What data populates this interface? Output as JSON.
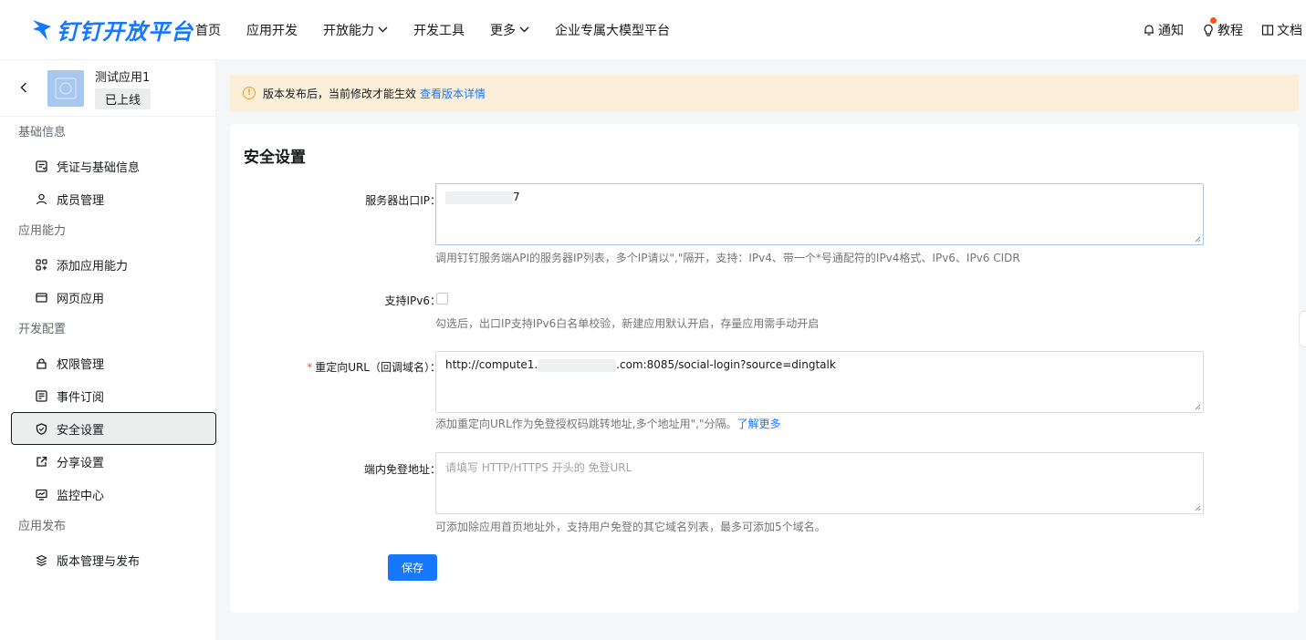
{
  "brand": {
    "name": "钉钉开放平台",
    "color": "#1677ff"
  },
  "nav": {
    "items": [
      {
        "label": "首页",
        "has_dropdown": false
      },
      {
        "label": "应用开发",
        "has_dropdown": false
      },
      {
        "label": "开放能力",
        "has_dropdown": true
      },
      {
        "label": "开发工具",
        "has_dropdown": false
      },
      {
        "label": "更多",
        "has_dropdown": true
      },
      {
        "label": "企业专属大模型平台",
        "has_dropdown": false
      }
    ],
    "right": {
      "notify": "通知",
      "tutorial": "教程",
      "docs": "文档"
    }
  },
  "app": {
    "name": "测试应用1",
    "status": "已上线"
  },
  "sidebar": {
    "groups": [
      {
        "title": "基础信息",
        "items": [
          {
            "label": "凭证与基础信息",
            "icon": "credential-icon"
          },
          {
            "label": "成员管理",
            "icon": "member-icon"
          }
        ]
      },
      {
        "title": "应用能力",
        "items": [
          {
            "label": "添加应用能力",
            "icon": "add-capability-icon"
          },
          {
            "label": "网页应用",
            "icon": "webpage-icon"
          }
        ]
      },
      {
        "title": "开发配置",
        "items": [
          {
            "label": "权限管理",
            "icon": "lock-icon"
          },
          {
            "label": "事件订阅",
            "icon": "event-icon"
          },
          {
            "label": "安全设置",
            "icon": "shield-icon",
            "active": true
          },
          {
            "label": "分享设置",
            "icon": "share-icon"
          },
          {
            "label": "监控中心",
            "icon": "monitor-icon"
          }
        ]
      },
      {
        "title": "应用发布",
        "items": [
          {
            "label": "版本管理与发布",
            "icon": "layers-icon"
          }
        ]
      }
    ]
  },
  "banner": {
    "text": "版本发布后，当前修改才能生效",
    "link": "查看版本详情"
  },
  "page": {
    "title": "安全设置"
  },
  "form": {
    "server_ip": {
      "label": "服务器出口IP：",
      "value_suffix": "7",
      "help": "调用钉钉服务端API的服务器IP列表，多个IP请以\",\"隔开，支持：IPv4、带一个*号通配符的IPv4格式、IPv6、IPv6 CIDR"
    },
    "ipv6": {
      "label": "支持IPv6：",
      "checked": false,
      "help": "勾选后，出口IP支持IPv6白名单校验，新建应用默认开启，存量应用需手动开启"
    },
    "redirect_url": {
      "label": "重定向URL（回调域名）：",
      "required": true,
      "value_prefix": "http://compute1.",
      "value_suffix": ".com:8085/social-login?source=dingtalk",
      "help": "添加重定向URL作为免登授权码跳转地址,多个地址用\",\"分隔。",
      "help_link": "了解更多"
    },
    "sso_url": {
      "label": "端内免登地址：",
      "placeholder": "请填写 HTTP/HTTPS 开头的 免登URL",
      "help": "可添加除应用首页地址外，支持用户免登的其它域名列表，最多可添加5个域名。"
    },
    "save_label": "保存"
  },
  "colors": {
    "accent": "#1677ff",
    "warning_bg": "#fcefd9",
    "warning_icon": "#f59c1b",
    "required": "#ff5219"
  }
}
